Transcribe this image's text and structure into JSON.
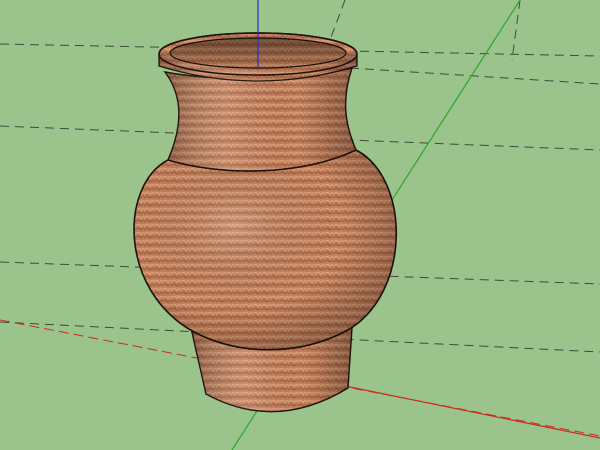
{
  "viewport": {
    "background": "#9ac48c",
    "grid_color": "#3f4a3a"
  },
  "axes": {
    "red": "#cc2b1d",
    "green": "#2aa62a",
    "blue": "#2b2bd6"
  },
  "model": {
    "name": "vase",
    "base_color": "#c4825d",
    "light_color": "#e0a17e",
    "shadow_color": "#8d5238",
    "outline_color": "#1f120c"
  }
}
